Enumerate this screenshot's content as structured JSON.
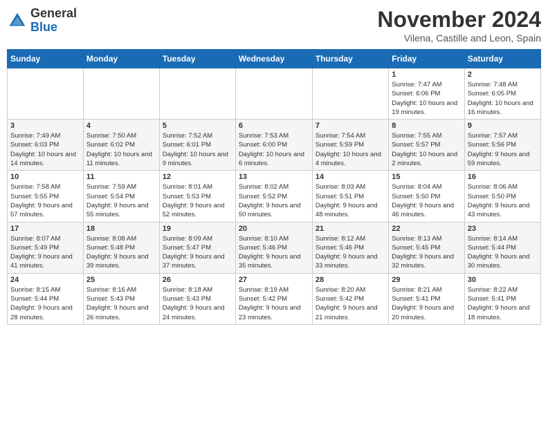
{
  "header": {
    "logo_general": "General",
    "logo_blue": "Blue",
    "month_title": "November 2024",
    "location": "Vilena, Castille and Leon, Spain"
  },
  "calendar": {
    "days_of_week": [
      "Sunday",
      "Monday",
      "Tuesday",
      "Wednesday",
      "Thursday",
      "Friday",
      "Saturday"
    ],
    "weeks": [
      [
        {
          "day": "",
          "info": ""
        },
        {
          "day": "",
          "info": ""
        },
        {
          "day": "",
          "info": ""
        },
        {
          "day": "",
          "info": ""
        },
        {
          "day": "",
          "info": ""
        },
        {
          "day": "1",
          "info": "Sunrise: 7:47 AM\nSunset: 6:06 PM\nDaylight: 10 hours and 19 minutes."
        },
        {
          "day": "2",
          "info": "Sunrise: 7:48 AM\nSunset: 6:05 PM\nDaylight: 10 hours and 16 minutes."
        }
      ],
      [
        {
          "day": "3",
          "info": "Sunrise: 7:49 AM\nSunset: 6:03 PM\nDaylight: 10 hours and 14 minutes."
        },
        {
          "day": "4",
          "info": "Sunrise: 7:50 AM\nSunset: 6:02 PM\nDaylight: 10 hours and 11 minutes."
        },
        {
          "day": "5",
          "info": "Sunrise: 7:52 AM\nSunset: 6:01 PM\nDaylight: 10 hours and 9 minutes."
        },
        {
          "day": "6",
          "info": "Sunrise: 7:53 AM\nSunset: 6:00 PM\nDaylight: 10 hours and 6 minutes."
        },
        {
          "day": "7",
          "info": "Sunrise: 7:54 AM\nSunset: 5:59 PM\nDaylight: 10 hours and 4 minutes."
        },
        {
          "day": "8",
          "info": "Sunrise: 7:55 AM\nSunset: 5:57 PM\nDaylight: 10 hours and 2 minutes."
        },
        {
          "day": "9",
          "info": "Sunrise: 7:57 AM\nSunset: 5:56 PM\nDaylight: 9 hours and 59 minutes."
        }
      ],
      [
        {
          "day": "10",
          "info": "Sunrise: 7:58 AM\nSunset: 5:55 PM\nDaylight: 9 hours and 57 minutes."
        },
        {
          "day": "11",
          "info": "Sunrise: 7:59 AM\nSunset: 5:54 PM\nDaylight: 9 hours and 55 minutes."
        },
        {
          "day": "12",
          "info": "Sunrise: 8:01 AM\nSunset: 5:53 PM\nDaylight: 9 hours and 52 minutes."
        },
        {
          "day": "13",
          "info": "Sunrise: 8:02 AM\nSunset: 5:52 PM\nDaylight: 9 hours and 50 minutes."
        },
        {
          "day": "14",
          "info": "Sunrise: 8:03 AM\nSunset: 5:51 PM\nDaylight: 9 hours and 48 minutes."
        },
        {
          "day": "15",
          "info": "Sunrise: 8:04 AM\nSunset: 5:50 PM\nDaylight: 9 hours and 46 minutes."
        },
        {
          "day": "16",
          "info": "Sunrise: 8:06 AM\nSunset: 5:50 PM\nDaylight: 9 hours and 43 minutes."
        }
      ],
      [
        {
          "day": "17",
          "info": "Sunrise: 8:07 AM\nSunset: 5:49 PM\nDaylight: 9 hours and 41 minutes."
        },
        {
          "day": "18",
          "info": "Sunrise: 8:08 AM\nSunset: 5:48 PM\nDaylight: 9 hours and 39 minutes."
        },
        {
          "day": "19",
          "info": "Sunrise: 8:09 AM\nSunset: 5:47 PM\nDaylight: 9 hours and 37 minutes."
        },
        {
          "day": "20",
          "info": "Sunrise: 8:10 AM\nSunset: 5:46 PM\nDaylight: 9 hours and 35 minutes."
        },
        {
          "day": "21",
          "info": "Sunrise: 8:12 AM\nSunset: 5:46 PM\nDaylight: 9 hours and 33 minutes."
        },
        {
          "day": "22",
          "info": "Sunrise: 8:13 AM\nSunset: 5:45 PM\nDaylight: 9 hours and 32 minutes."
        },
        {
          "day": "23",
          "info": "Sunrise: 8:14 AM\nSunset: 5:44 PM\nDaylight: 9 hours and 30 minutes."
        }
      ],
      [
        {
          "day": "24",
          "info": "Sunrise: 8:15 AM\nSunset: 5:44 PM\nDaylight: 9 hours and 28 minutes."
        },
        {
          "day": "25",
          "info": "Sunrise: 8:16 AM\nSunset: 5:43 PM\nDaylight: 9 hours and 26 minutes."
        },
        {
          "day": "26",
          "info": "Sunrise: 8:18 AM\nSunset: 5:43 PM\nDaylight: 9 hours and 24 minutes."
        },
        {
          "day": "27",
          "info": "Sunrise: 8:19 AM\nSunset: 5:42 PM\nDaylight: 9 hours and 23 minutes."
        },
        {
          "day": "28",
          "info": "Sunrise: 8:20 AM\nSunset: 5:42 PM\nDaylight: 9 hours and 21 minutes."
        },
        {
          "day": "29",
          "info": "Sunrise: 8:21 AM\nSunset: 5:41 PM\nDaylight: 9 hours and 20 minutes."
        },
        {
          "day": "30",
          "info": "Sunrise: 8:22 AM\nSunset: 5:41 PM\nDaylight: 9 hours and 18 minutes."
        }
      ]
    ]
  }
}
